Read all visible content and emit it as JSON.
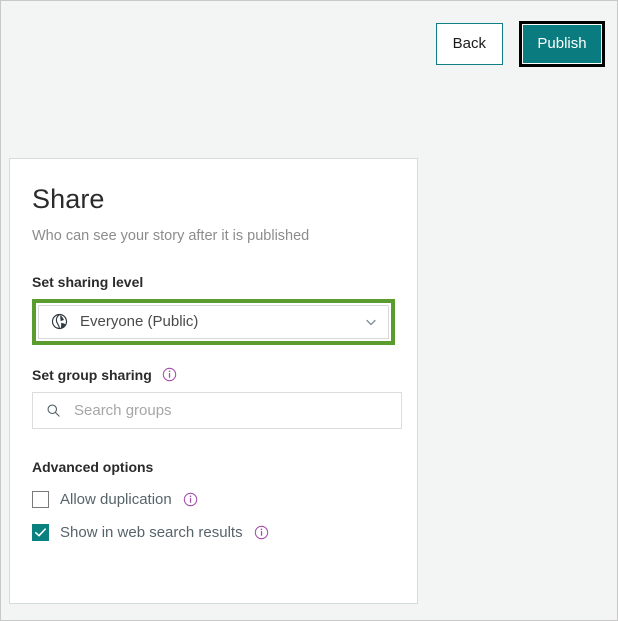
{
  "window": {
    "background_color": "#f3f5f4",
    "border_color": "#c8c8c8"
  },
  "action_bar": {
    "back_label": "Back",
    "publish_label": "Publish",
    "publish_bg_color": "#0a7b7f",
    "publish_focus_ring_color": "#000000",
    "back_border_color": "#0f7f84"
  },
  "share_panel": {
    "title": "Share",
    "subtitle": "Who can see your story after it is published",
    "sharing_level": {
      "label": "Set sharing level",
      "selected_value": "Everyone (Public)",
      "icon": "globe-icon",
      "chevron": "chevron-down-icon",
      "highlight_color": "#5b9c2f"
    },
    "group_sharing": {
      "label": "Set group sharing",
      "info_icon": "info-icon",
      "search_placeholder": "Search groups",
      "search_value": "",
      "search_icon": "search-icon"
    },
    "advanced_options": {
      "label": "Advanced options",
      "options": [
        {
          "label": "Allow duplication",
          "checked": false,
          "info_icon": "info-icon"
        },
        {
          "label": "Show in web search results",
          "checked": true,
          "info_icon": "info-icon"
        }
      ],
      "checked_color": "#0a8080",
      "info_icon_color": "#a24ca8"
    }
  }
}
